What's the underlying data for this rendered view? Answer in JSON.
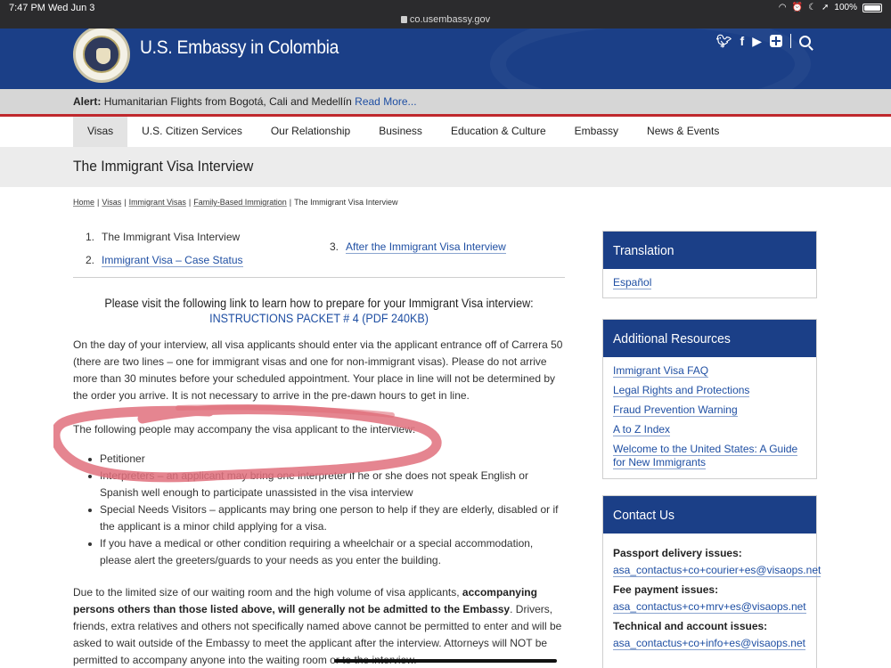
{
  "status_bar": {
    "time": "7:47 PM",
    "date": "Wed Jun 3",
    "url": "co.usembassy.gov",
    "battery": "100%"
  },
  "header": {
    "site_title": "U.S. Embassy in Colombia"
  },
  "alert": {
    "label": "Alert:",
    "text": "Humanitarian Flights from Bogotá, Cali and Medellín",
    "link": "Read More..."
  },
  "nav": {
    "items": [
      "Visas",
      "U.S. Citizen Services",
      "Our Relationship",
      "Business",
      "Education & Culture",
      "Embassy",
      "News & Events"
    ],
    "active": "Visas"
  },
  "page_title": "The Immigrant Visa Interview",
  "breadcrumb": {
    "items": [
      "Home",
      "Visas",
      "Immigrant Visas",
      "Family-Based Immigration"
    ],
    "current": "The Immigrant Visa Interview"
  },
  "subnav": [
    {
      "num": "1.",
      "label": "The Immigrant Visa Interview"
    },
    {
      "num": "2.",
      "label": "Immigrant Visa – Case Status"
    },
    {
      "num": "3.",
      "label": "After the Immigrant Visa Interview"
    }
  ],
  "instructions": {
    "text": "Please visit the following link to learn how to prepare for your Immigrant Visa interview:",
    "link": "INSTRUCTIONS PACKET # 4 (PDF 240KB)"
  },
  "paragraph1": "On the day of your interview, all visa applicants should enter via the applicant entrance off of Carrera 50 (there are two lines – one for immigrant visas and one for non-immigrant visas). Please do not arrive more than 30 minutes before your scheduled appointment. Your place in line will not be determined by the order you arrive. It is not necessary to arrive in the pre-dawn hours to get in line.",
  "paragraph2": "The following people may accompany the visa applicant to the interview:",
  "bullets": [
    "Petitioner",
    "Interpreters – an applicant may bring one interpreter if he or she does not speak English or Spanish well enough to participate unassisted in the visa interview",
    "Special Needs Visitors – applicants may bring one person to help if they are elderly, disabled or if the applicant is a minor child applying for a visa.",
    "If you have a medical or other condition requiring a wheelchair or a special accommodation, please alert the greeters/guards to your needs as you enter the building."
  ],
  "paragraph3": {
    "pre": "Due to the limited size of our waiting room and the high volume of visa applicants,",
    "bold": "accompanying persons others than those listed above, will generally not be admitted to the Embassy",
    "post": ". Drivers, friends, extra relatives and others not specifically named above cannot be permitted to enter and will be asked to wait outside of the Embassy to meet the applicant after the interview. Attorneys will NOT be permitted to accompany anyone into the waiting room or to the interview."
  },
  "sidebar": {
    "translation": {
      "title": "Translation",
      "link": "Español"
    },
    "resources": {
      "title": "Additional Resources",
      "links": [
        "Immigrant Visa FAQ",
        "Legal Rights and Protections",
        "Fraud Prevention Warning",
        "A to Z Index",
        "Welcome to the United States: A Guide for New Immigrants"
      ]
    },
    "contact": {
      "title": "Contact Us",
      "items": [
        {
          "label": "Passport delivery issues",
          "email": "asa_contactus+co+courier+es@visaops.net"
        },
        {
          "label": "Fee payment issues",
          "email": "asa_contactus+co+mrv+es@visaops.net"
        },
        {
          "label": "Technical and account issues",
          "email": "asa_contactus+co+info+es@visaops.net"
        }
      ]
    }
  },
  "colors": {
    "brand_blue": "#1b3f87",
    "alert_red": "#c0282d",
    "link_blue": "#1f4fa3",
    "annotation": "#e0707c"
  }
}
